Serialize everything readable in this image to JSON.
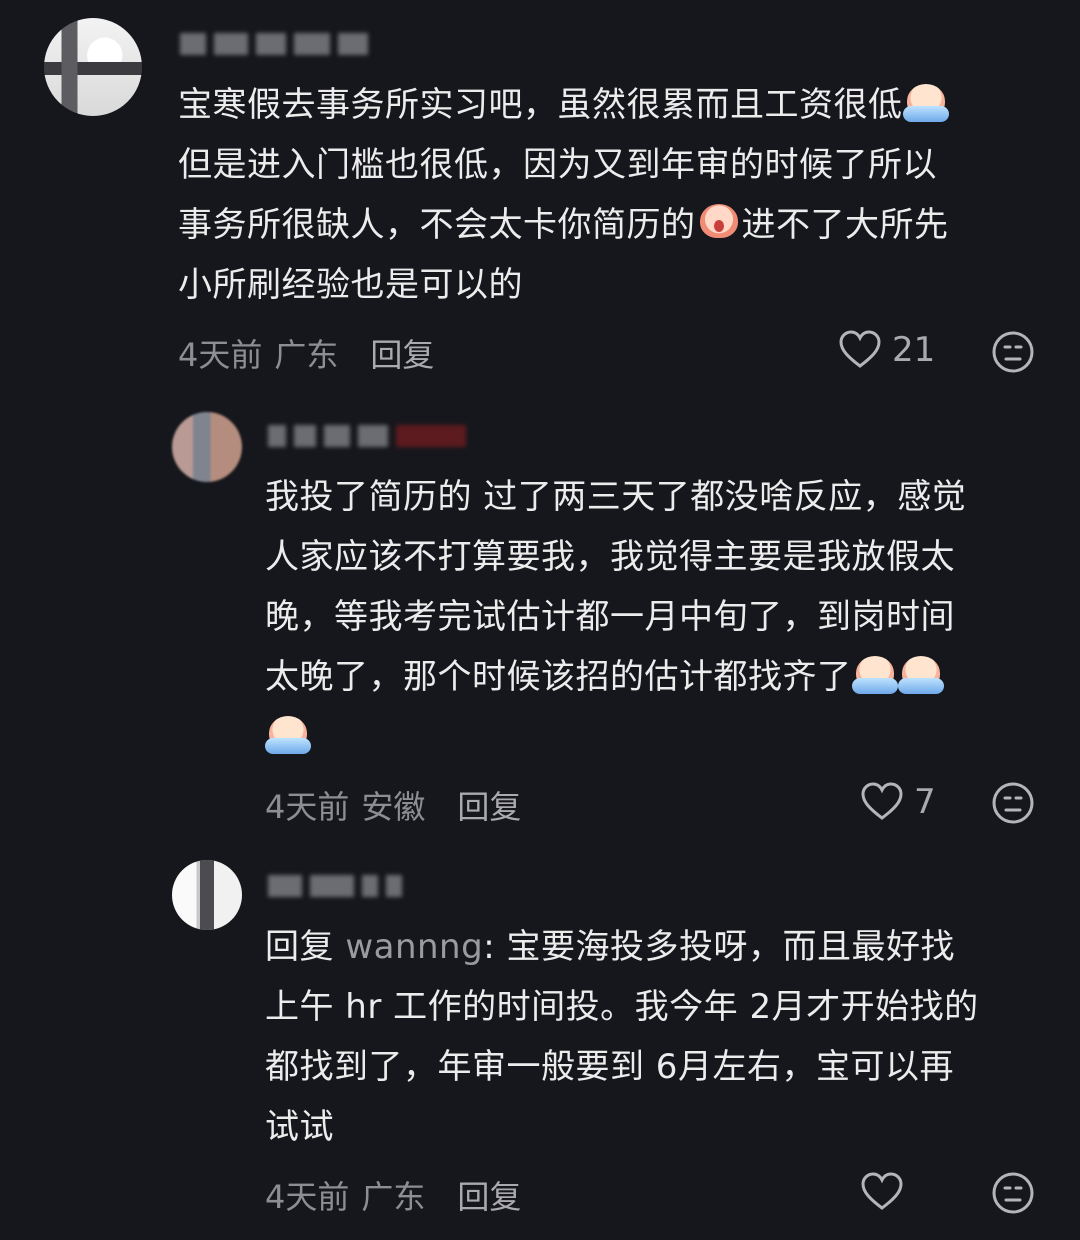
{
  "comments": [
    {
      "text_line1": "宝寒假去事务所实习吧，虽然很累而且工资很低",
      "text_line2": "但是进入门槛也很低，因为又到年审的时候了所以",
      "text_line3a": "事务所很缺人，不会太卡你简历的",
      "text_line3b": "进不了大所先",
      "text_line4": "小所刷经验也是可以的",
      "time": "4天前",
      "location": "广东",
      "reply_label": "回复",
      "like_count": "21",
      "icons": [
        "heart-icon",
        "dislike-face-icon",
        "crying-emoji-icon",
        "shocked-emoji-icon"
      ]
    },
    {
      "text_line1": "我投了简历的 过了两三天了都没啥反应，感觉",
      "text_line2": "人家应该不打算要我，我觉得主要是我放假太",
      "text_line3": "晚，等我考完试估计都一月中旬了，到岗时间",
      "text_line4": "太晚了，那个时候该招的估计都找齐了",
      "time": "4天前",
      "location": "安徽",
      "reply_label": "回复",
      "like_count": "7",
      "icons": [
        "heart-icon",
        "dislike-face-icon",
        "crying-emoji-icon"
      ]
    },
    {
      "reply_prefix": "回复",
      "reply_target": "wannng",
      "text_line1": ": 宝要海投多投呀，而且最好找",
      "text_line2": "上午 hr 工作的时间投。我今年 2月才开始找的",
      "text_line3": "都找到了，年审一般要到 6月左右，宝可以再",
      "text_line4": "试试",
      "time": "4天前",
      "location": "广东",
      "reply_label": "回复",
      "icons": [
        "heart-icon",
        "dislike-face-icon"
      ]
    }
  ],
  "colors": {
    "background": "#16171c",
    "text": "#ececed",
    "meta": "#8d8d92"
  }
}
